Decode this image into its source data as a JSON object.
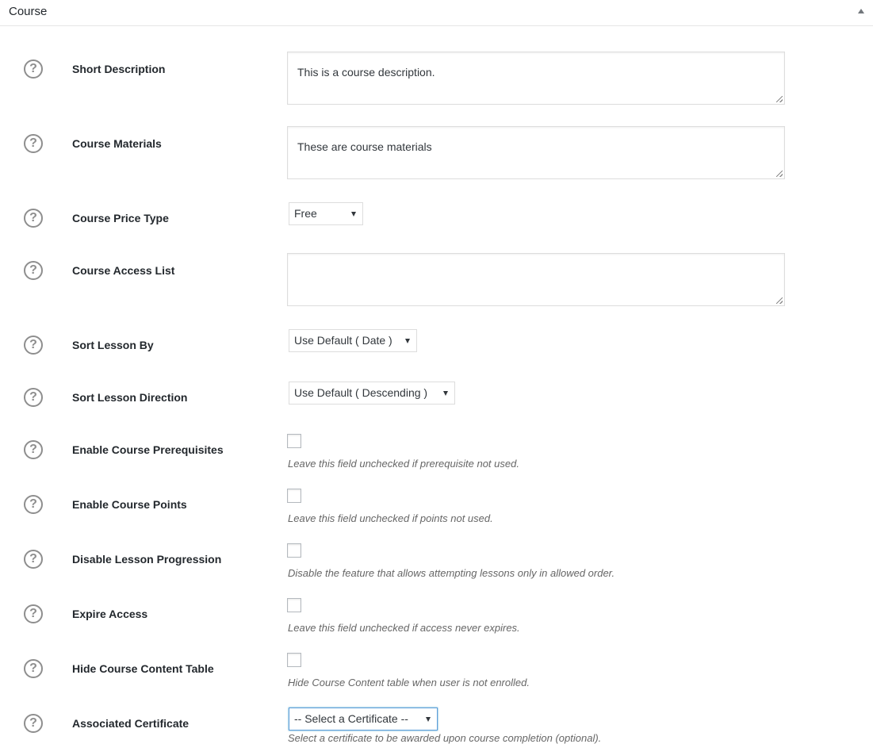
{
  "panel": {
    "title": "Course"
  },
  "fields": [
    {
      "label": "Short Description",
      "type": "textarea",
      "value": "This is a course description."
    },
    {
      "label": "Course Materials",
      "type": "textarea",
      "value": "These are course materials"
    },
    {
      "label": "Course Price Type",
      "type": "select",
      "value": "Free"
    },
    {
      "label": "Course Access List",
      "type": "textarea",
      "value": ""
    },
    {
      "label": "Sort Lesson By",
      "type": "select",
      "value": "Use Default ( Date )"
    },
    {
      "label": "Sort Lesson Direction",
      "type": "select",
      "value": "Use Default ( Descending )"
    },
    {
      "label": "Enable Course Prerequisites",
      "type": "checkbox",
      "checked": false,
      "description": "Leave this field unchecked if prerequisite not used."
    },
    {
      "label": "Enable Course Points",
      "type": "checkbox",
      "checked": false,
      "description": "Leave this field unchecked if points not used."
    },
    {
      "label": "Disable Lesson Progression",
      "type": "checkbox",
      "checked": false,
      "description": "Disable the feature that allows attempting lessons only in allowed order."
    },
    {
      "label": "Expire Access",
      "type": "checkbox",
      "checked": false,
      "description": "Leave this field unchecked if access never expires."
    },
    {
      "label": "Hide Course Content Table",
      "type": "checkbox",
      "checked": false,
      "description": "Hide Course Content table when user is not enrolled."
    },
    {
      "label": "Associated Certificate",
      "type": "select",
      "value": "-- Select a Certificate --",
      "description": "Select a certificate to be awarded upon course completion (optional)."
    }
  ],
  "help_icon_glyph": "?",
  "colors": {
    "focus_border": "#5b9dd9",
    "label_text": "#23282d",
    "description_text": "#666666"
  }
}
